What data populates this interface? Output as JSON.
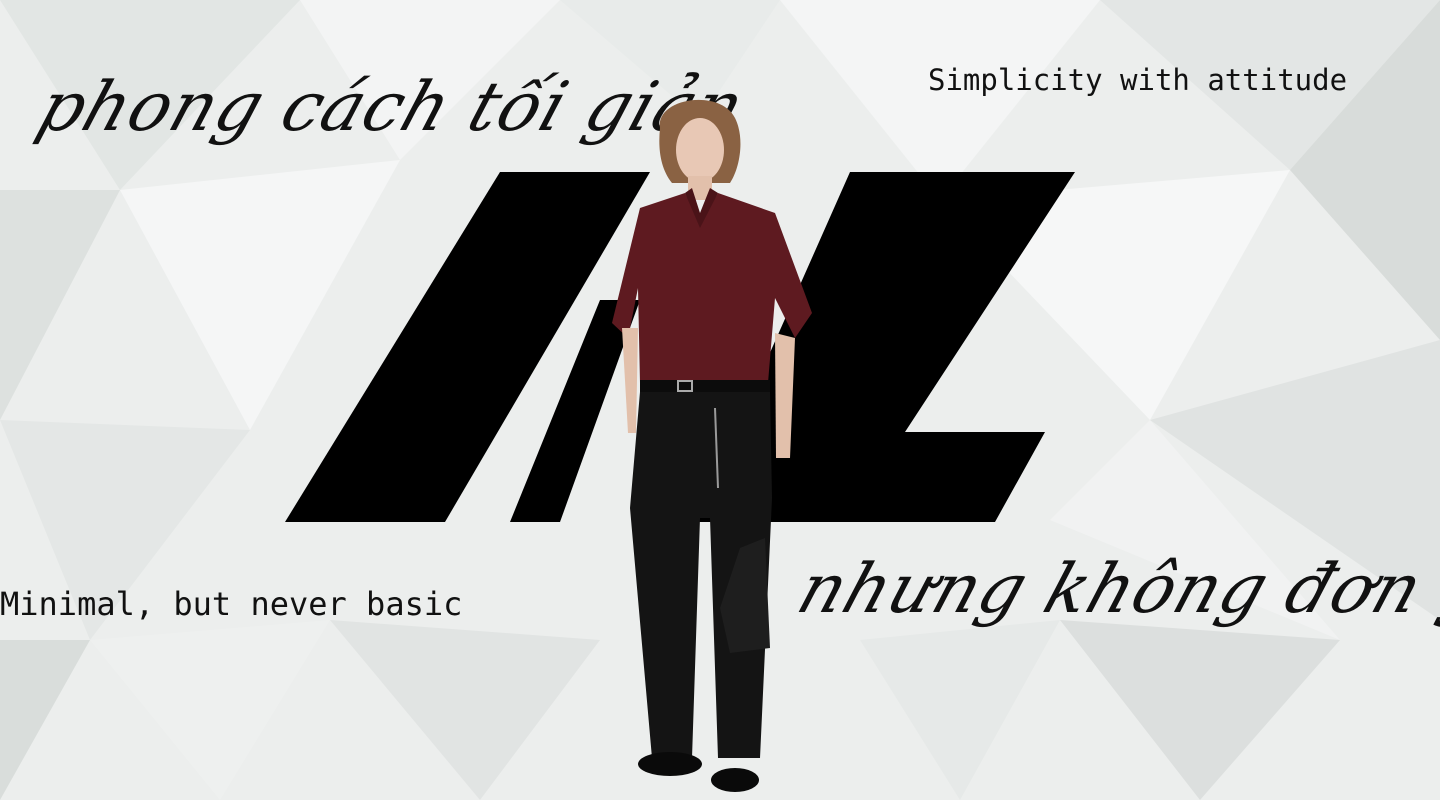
{
  "banner": {
    "tagline_vi_top": "phong cách tối giản",
    "tagline_en_top": "Simplicity with attitude",
    "tagline_en_bottom": "Minimal, but never basic",
    "tagline_vi_bottom": "nhưng không đơn giản",
    "logo": "AL",
    "colors": {
      "background": "#eef0ef",
      "text": "#111111",
      "logo": "#000000",
      "shirt": "#5e1a20",
      "trousers": "#141414"
    }
  }
}
